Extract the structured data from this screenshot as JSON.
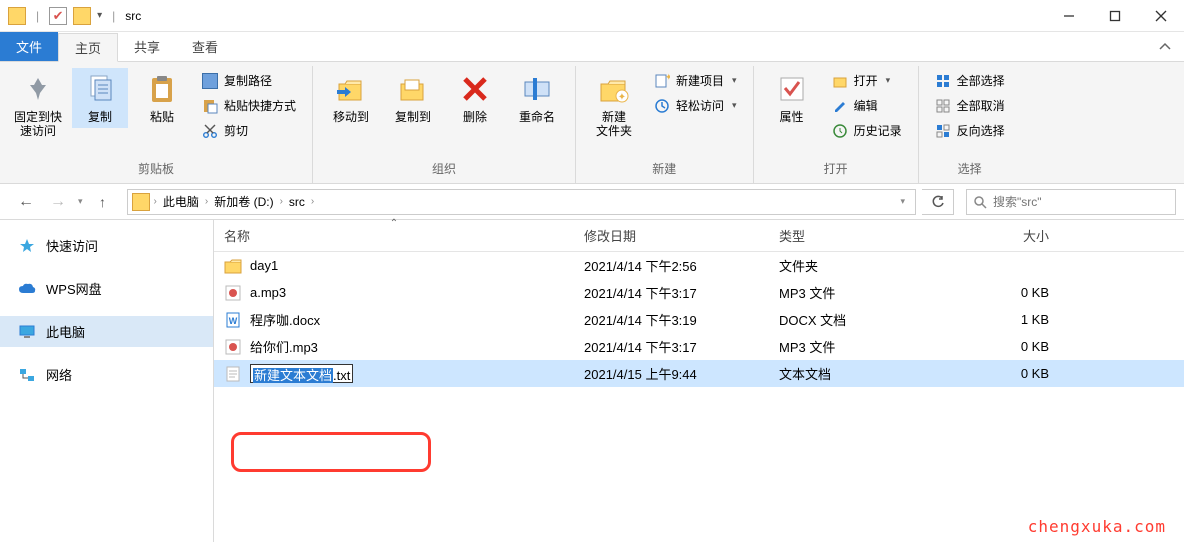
{
  "window": {
    "title": "src"
  },
  "tabs": {
    "file": "文件",
    "home": "主页",
    "share": "共享",
    "view": "查看"
  },
  "ribbon": {
    "pin": "固定到快\n速访问",
    "copy": "复制",
    "paste": "粘贴",
    "copy_path": "复制路径",
    "paste_shortcut": "粘贴快捷方式",
    "cut": "剪切",
    "group_clipboard": "剪贴板",
    "move_to": "移动到",
    "copy_to": "复制到",
    "delete": "删除",
    "rename": "重命名",
    "group_organize": "组织",
    "new_folder": "新建\n文件夹",
    "new_item": "新建项目",
    "easy_access": "轻松访问",
    "group_new": "新建",
    "properties": "属性",
    "open": "打开",
    "edit": "编辑",
    "history": "历史记录",
    "group_open": "打开",
    "select_all": "全部选择",
    "select_none": "全部取消",
    "invert": "反向选择",
    "group_select": "选择"
  },
  "breadcrumb": {
    "pc": "此电脑",
    "drive": "新加卷 (D:)",
    "folder": "src"
  },
  "search": {
    "placeholder": "搜索\"src\""
  },
  "sidebar": {
    "quick": "快速访问",
    "wps": "WPS网盘",
    "pc": "此电脑",
    "network": "网络"
  },
  "columns": {
    "name": "名称",
    "date": "修改日期",
    "type": "类型",
    "size": "大小"
  },
  "files": [
    {
      "icon": "folder",
      "name": "day1",
      "date": "2021/4/14 下午2:56",
      "type": "文件夹",
      "size": ""
    },
    {
      "icon": "audio",
      "name": "a.mp3",
      "date": "2021/4/14 下午3:17",
      "type": "MP3 文件",
      "size": "0 KB"
    },
    {
      "icon": "doc",
      "name": "程序咖.docx",
      "date": "2021/4/14 下午3:19",
      "type": "DOCX 文档",
      "size": "1 KB"
    },
    {
      "icon": "audio",
      "name": "给你们.mp3",
      "date": "2021/4/14 下午3:17",
      "type": "MP3 文件",
      "size": "0 KB"
    },
    {
      "icon": "text",
      "name_sel": "新建文本文档",
      "name_ext": ".txt",
      "date": "2021/4/15 上午9:44",
      "type": "文本文档",
      "size": "0 KB",
      "editing": true
    }
  ],
  "watermark": "chengxuka.com"
}
